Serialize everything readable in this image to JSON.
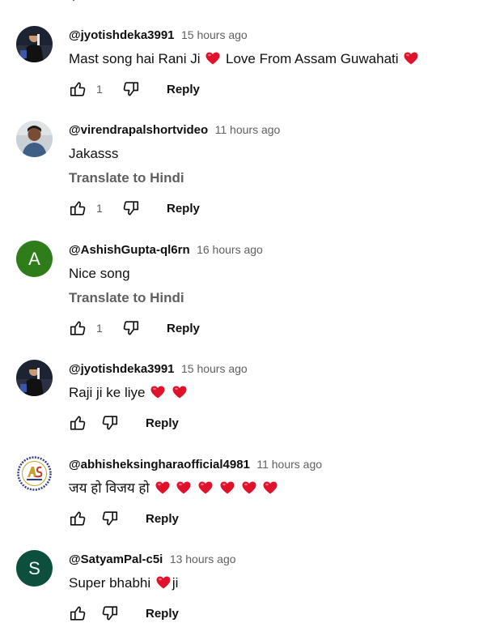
{
  "comments": [
    {
      "author": "@jyotishdeka3991",
      "time": "15 hours ago",
      "text_parts": [
        "Mast song hai Rani Ji",
        "Love From Assam Guwahati"
      ],
      "likes": "1",
      "reply_label": "Reply",
      "avatar_style": "photo"
    },
    {
      "author": "@virendrapalshortvideo",
      "time": "11 hours ago",
      "text": "Jakasss",
      "translate_label": "Translate to Hindi",
      "likes": "1",
      "reply_label": "Reply",
      "avatar_style": "photo"
    },
    {
      "author": "@AshishGupta-ql6rn",
      "time": "16 hours ago",
      "text": "Nice song",
      "translate_label": "Translate to Hindi",
      "likes": "1",
      "reply_label": "Reply",
      "avatar_letter": "A",
      "avatar_color": "#2e7d1a"
    },
    {
      "author": "@jyotishdeka3991",
      "time": "15 hours ago",
      "text": "Raji ji ke liye",
      "reply_label": "Reply",
      "avatar_style": "photo"
    },
    {
      "author": "@abhisheksingharaofficial4981",
      "time": "11 hours ago",
      "text": "जय हो विजय हो",
      "reply_label": "Reply",
      "avatar_style": "logo"
    },
    {
      "author": "@SatyamPal-c5i",
      "time": "13 hours ago",
      "text_parts": [
        "Super bhabhi",
        "ji"
      ],
      "reply_label": "Reply",
      "avatar_letter": "S",
      "avatar_color": "#0b4f3c"
    }
  ],
  "colors": {
    "heart": "#e0112b",
    "secondary_text": "#606060",
    "primary_text": "#0f0f0f"
  },
  "icons": {
    "like": "thumbs-up-icon",
    "dislike": "thumbs-down-icon",
    "heart": "heart-emoji-icon"
  }
}
